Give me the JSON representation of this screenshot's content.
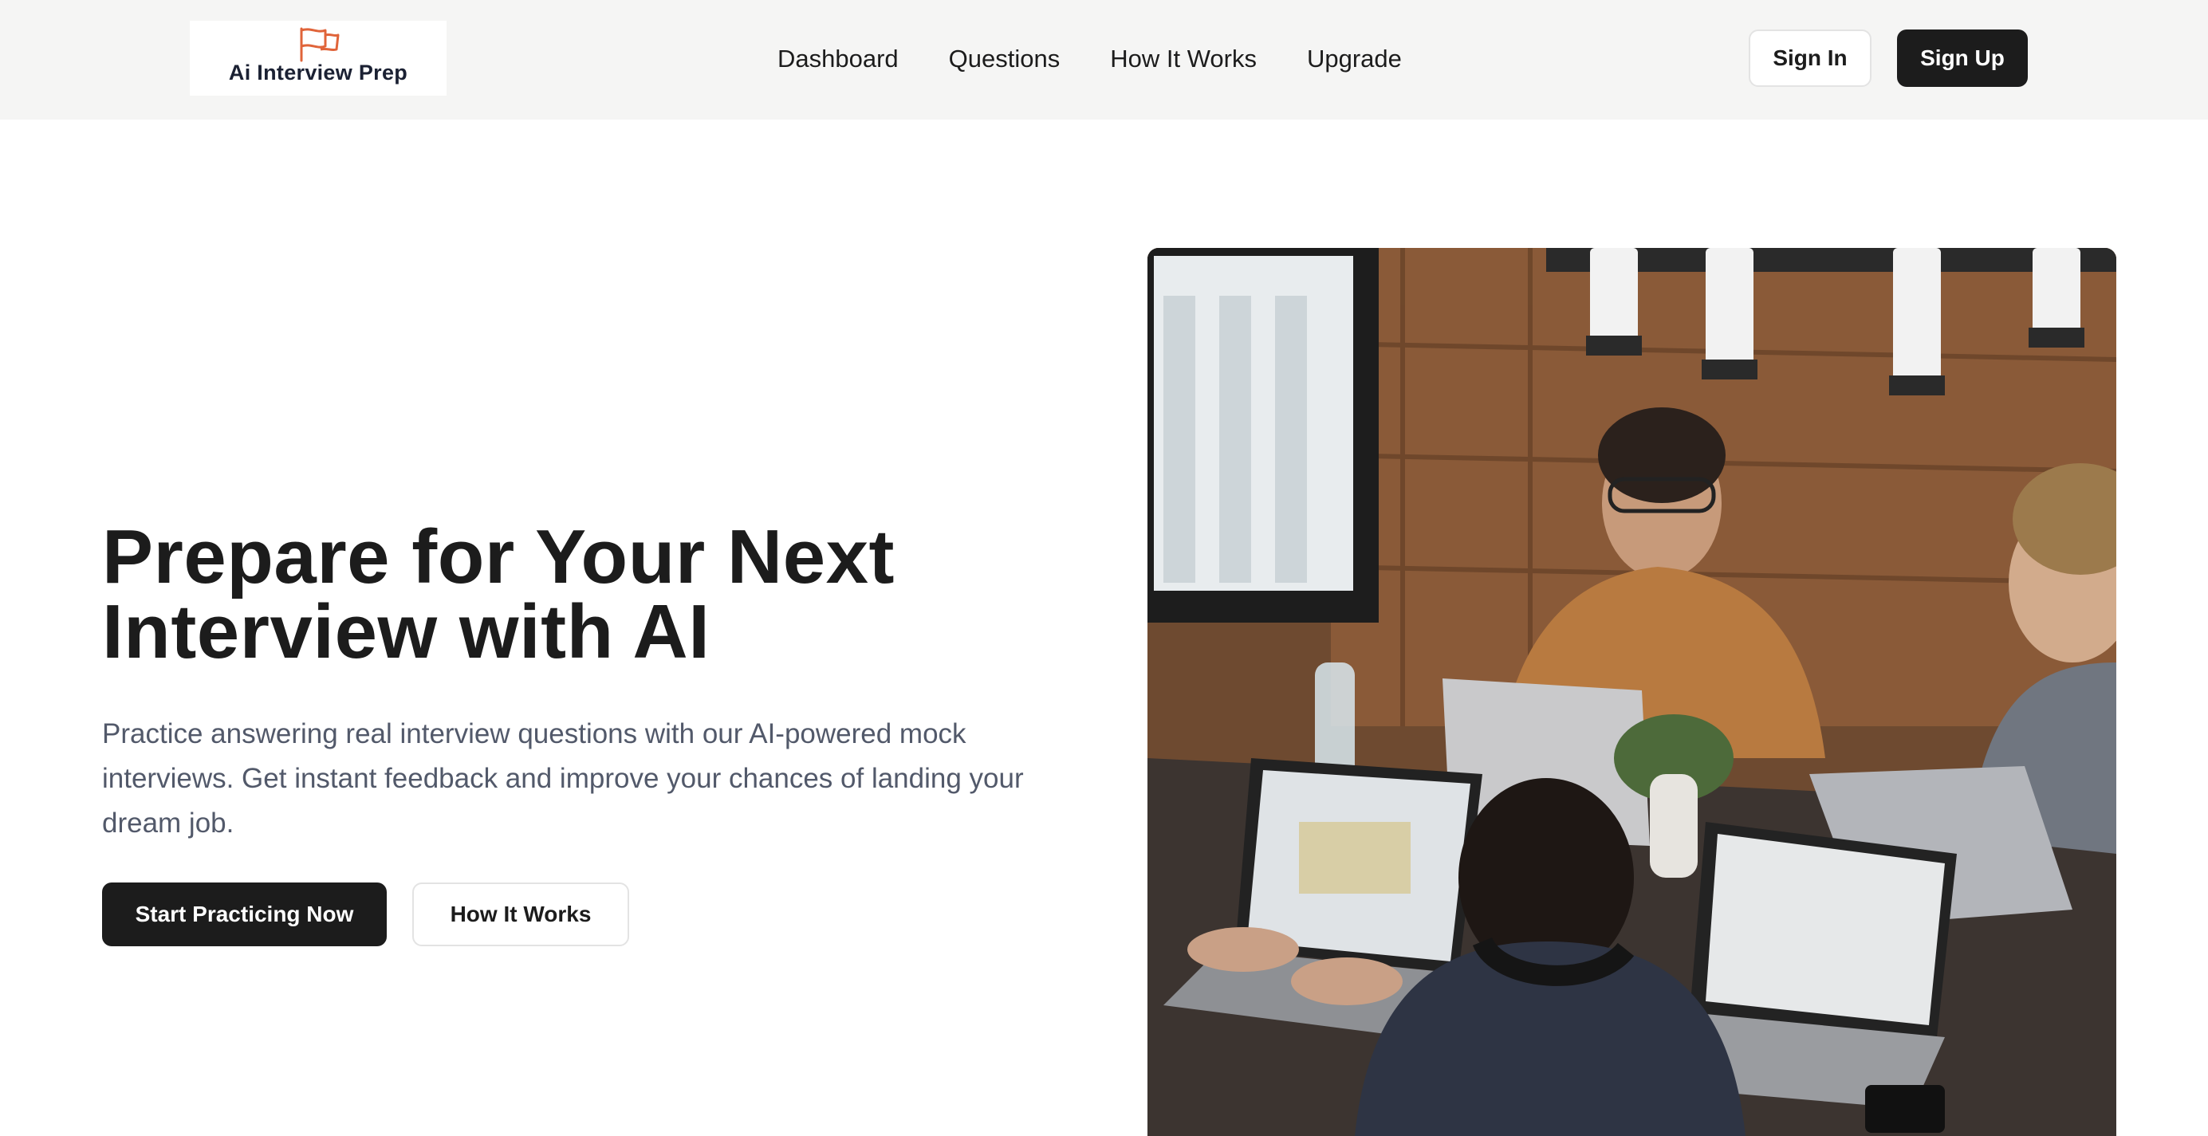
{
  "brand": {
    "name": "Ai Interview Prep",
    "flag_color": "#e0643a"
  },
  "nav": {
    "items": [
      {
        "label": "Dashboard"
      },
      {
        "label": "Questions"
      },
      {
        "label": "How It Works"
      },
      {
        "label": "Upgrade"
      }
    ]
  },
  "auth": {
    "sign_in": "Sign In",
    "sign_up": "Sign Up"
  },
  "hero": {
    "title": "Prepare for Your Next Interview with AI",
    "description": "Practice answering real interview questions with our AI-powered mock interviews. Get instant feedback and improve your chances of landing your dream job.",
    "primary_cta": "Start Practicing Now",
    "secondary_cta": "How It Works"
  },
  "colors": {
    "header_bg": "#f5f5f4",
    "primary": "#1c1c1c",
    "text_muted": "#52596a",
    "border": "#e3e3e3"
  }
}
